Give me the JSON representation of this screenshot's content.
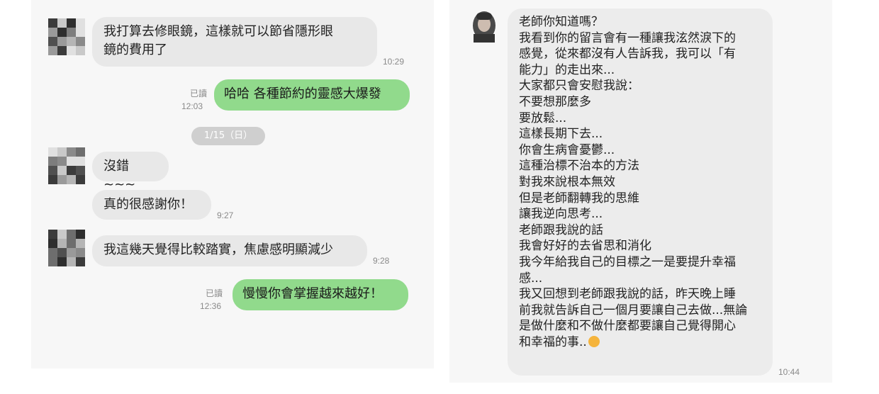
{
  "left_chat": {
    "messages": [
      {
        "id": "m1",
        "text": "我打算去修眼鏡，這樣就可以節省隱形眼\n鏡的費用了",
        "time": "10:29"
      },
      {
        "id": "m2",
        "text": "哈哈 各種節約的靈感大爆發",
        "read": "已讀",
        "time": "12:03"
      },
      {
        "id": "m3",
        "text": "沒錯~~~"
      },
      {
        "id": "m4",
        "text": "真的很感謝你！",
        "time": "9:27"
      },
      {
        "id": "m5",
        "text": "我這幾天覺得比較踏實，焦慮感明顯減少",
        "time": "9:28"
      },
      {
        "id": "m6",
        "text": "慢慢你會掌握越來越好！",
        "read": "已讀",
        "time": "12:36"
      }
    ],
    "date_separator": "1/15（日）"
  },
  "right_chat": {
    "lines": [
      "老師你知道嗎？",
      "我看到你的留言會有一種讓我泫然淚下的",
      "感覺，從來都沒有人告訴我，我可以「有",
      "能力」的走出來...",
      "大家都只會安慰我說：",
      "不要想那麼多",
      "要放鬆...",
      "這樣長期下去...",
      "你會生病會憂鬱...",
      "這種治標不治本的方法",
      "對我來說根本無效",
      "但是老師翻轉我的思維",
      "讓我逆向思考...",
      "老師跟我說的話",
      "我會好好的去省思和消化",
      "我今年給我自己的目標之一是要提升幸福",
      "感...",
      "我又回想到老師跟我說的話，昨天晚上睡",
      "前我就告訴自己一個月要讓自己去做...無論",
      "是做什麼和不做什麼都要讓自己覺得開心",
      "和幸福的事.."
    ],
    "time": "10:44"
  },
  "icons": {
    "blurred_avatar": "pixelated-avatar-icon",
    "profile_avatar": "profile-avatar-icon",
    "emoji": "smiling-face-with-hearts-icon"
  },
  "colors": {
    "outgoing_bubble": "#91da8c",
    "incoming_bubble": "#e8e8e8",
    "date_pill": "#cfcfcf"
  }
}
